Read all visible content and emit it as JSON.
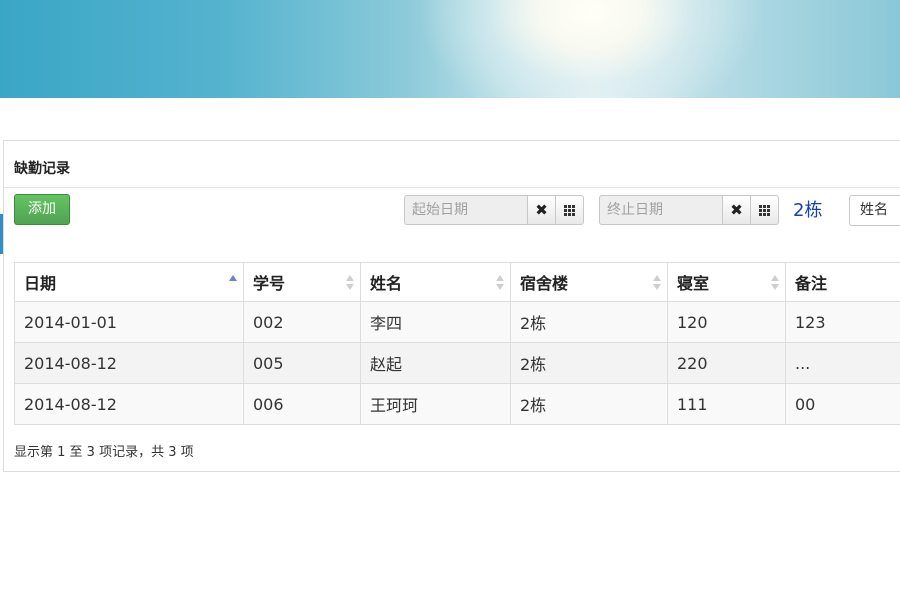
{
  "panel": {
    "title": "缺勤记录"
  },
  "toolbar": {
    "add_label": "添加",
    "start_date": {
      "placeholder": "起始日期",
      "value": ""
    },
    "end_date": {
      "placeholder": "终止日期",
      "value": ""
    },
    "clear_glyph": "✖",
    "building": "2栋",
    "search_field": "姓名"
  },
  "table": {
    "columns": [
      "日期",
      "学号",
      "姓名",
      "宿舍楼",
      "寝室",
      "备注"
    ],
    "sorted_column": "日期",
    "sort_direction": "asc",
    "rows": [
      [
        "2014-01-01",
        "002",
        "李四",
        "2栋",
        "120",
        "123"
      ],
      [
        "2014-08-12",
        "005",
        "赵起",
        "2栋",
        "220",
        "..."
      ],
      [
        "2014-08-12",
        "006",
        "王珂珂",
        "2栋",
        "111",
        "00"
      ]
    ]
  },
  "footer": {
    "info": "显示第 1 至 3 项记录，共 3 项"
  },
  "colors": {
    "accent_green": "#51a351",
    "building_text": "#1a3db8",
    "sort_active": "#6a7fd8"
  }
}
